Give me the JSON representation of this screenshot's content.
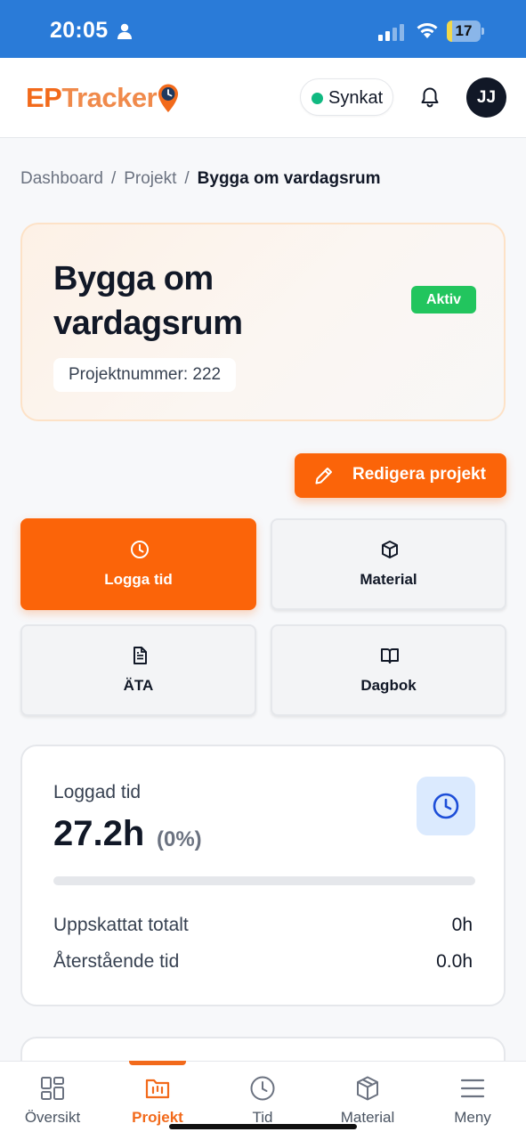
{
  "status_bar": {
    "time": "20:05",
    "battery": "17",
    "battery_level": 0.17,
    "person_icon": "person-icon",
    "signal_icon": "cellular-signal-icon",
    "wifi_icon": "wifi-icon"
  },
  "header": {
    "logo_ep": "EP",
    "logo_tracker": "Tracker",
    "sync_label": "Synkat",
    "avatar_initials": "JJ",
    "brand_color": "#f26a1b"
  },
  "breadcrumb": {
    "items": [
      "Dashboard",
      "Projekt",
      "Bygga om vardagsrum"
    ],
    "separator": "/"
  },
  "project": {
    "title": "Bygga om vardagsrum",
    "number_label": "Projektnummer: 222",
    "status": "Aktiv",
    "status_color": "#22c55e"
  },
  "edit_button": {
    "label": "Redigera projekt",
    "icon": "pencil-icon"
  },
  "actions": [
    {
      "label": "Logga tid",
      "icon": "clock-icon"
    },
    {
      "label": "Material",
      "icon": "box-icon"
    },
    {
      "label": "ÄTA",
      "icon": "document-icon"
    },
    {
      "label": "Dagbok",
      "icon": "book-icon"
    }
  ],
  "time_card": {
    "label": "Loggad tid",
    "value": "27.2h",
    "percent": "(0%)",
    "progress": 0,
    "estimated_label": "Uppskattat totalt",
    "estimated_value": "0h",
    "remaining_label": "Återstående tid",
    "remaining_value": "0.0h"
  },
  "nav": {
    "items": [
      {
        "label": "Översikt",
        "icon": "grid-icon"
      },
      {
        "label": "Projekt",
        "icon": "folder-chart-icon"
      },
      {
        "label": "Tid",
        "icon": "clock-icon"
      },
      {
        "label": "Material",
        "icon": "box-icon"
      },
      {
        "label": "Meny",
        "icon": "menu-icon"
      }
    ],
    "active_index": 1
  }
}
